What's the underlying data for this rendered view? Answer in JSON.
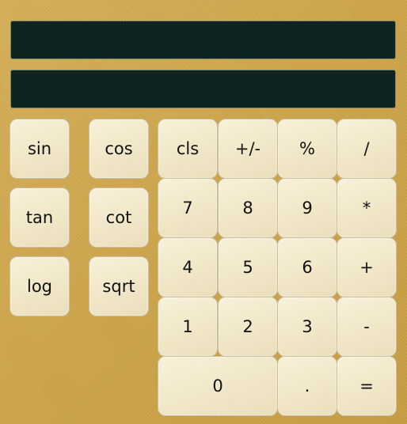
{
  "display": {
    "expression": "",
    "result": ""
  },
  "sci": {
    "sin": "sin",
    "cos": "cos",
    "tan": "tan",
    "cot": "cot",
    "log": "log",
    "sqrt": "sqrt"
  },
  "keys": {
    "cls": "cls",
    "negate": "+/-",
    "percent": "%",
    "divide": "/",
    "seven": "7",
    "eight": "8",
    "nine": "9",
    "multiply": "*",
    "four": "4",
    "five": "5",
    "six": "6",
    "plus": "+",
    "one": "1",
    "two": "2",
    "three": "3",
    "minus": "-",
    "zero": "0",
    "dot": ".",
    "equals": "="
  },
  "colors": {
    "background": "#d3ab4f",
    "display": "#0f2320",
    "button": "#f4ecd2"
  }
}
